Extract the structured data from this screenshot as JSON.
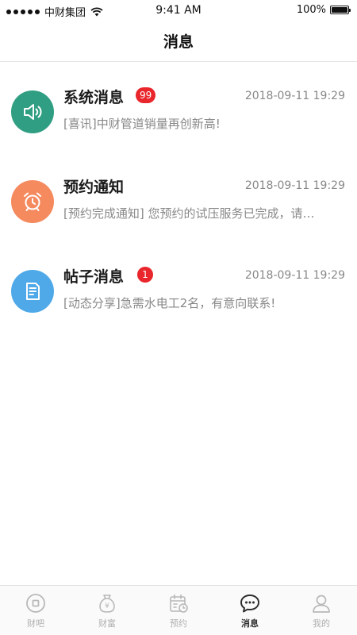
{
  "status_bar": {
    "carrier": "中财集团",
    "time": "9:41 AM",
    "battery": "100%"
  },
  "header": {
    "title": "消息"
  },
  "messages": [
    {
      "title": "系统消息",
      "badge": "99",
      "time": "2018-09-11 19:29",
      "preview": "[喜讯]中财管道销量再创新高!",
      "icon": "speaker-icon",
      "color": "#2f9e82"
    },
    {
      "title": "预约通知",
      "badge": "",
      "time": "2018-09-11 19:29",
      "preview": "[预约完成通知] 您预约的试压服务已完成，请…",
      "icon": "alarm-clock-icon",
      "color": "#f58a5e"
    },
    {
      "title": "帖子消息",
      "badge": "1",
      "time": "2018-09-11 19:29",
      "preview": "[动态分享]急需水电工2名，有意向联系!",
      "icon": "document-icon",
      "color": "#4fa9e8"
    }
  ],
  "tabs": [
    {
      "label": "财吧",
      "icon": "coin-icon"
    },
    {
      "label": "财富",
      "icon": "money-bag-icon"
    },
    {
      "label": "预约",
      "icon": "calendar-icon"
    },
    {
      "label": "消息",
      "icon": "chat-bubble-icon",
      "active": true
    },
    {
      "label": "我的",
      "icon": "user-icon"
    }
  ],
  "colors": {
    "badge": "#e8262c",
    "tab_inactive": "#b0b0b0",
    "tab_active": "#333333"
  }
}
